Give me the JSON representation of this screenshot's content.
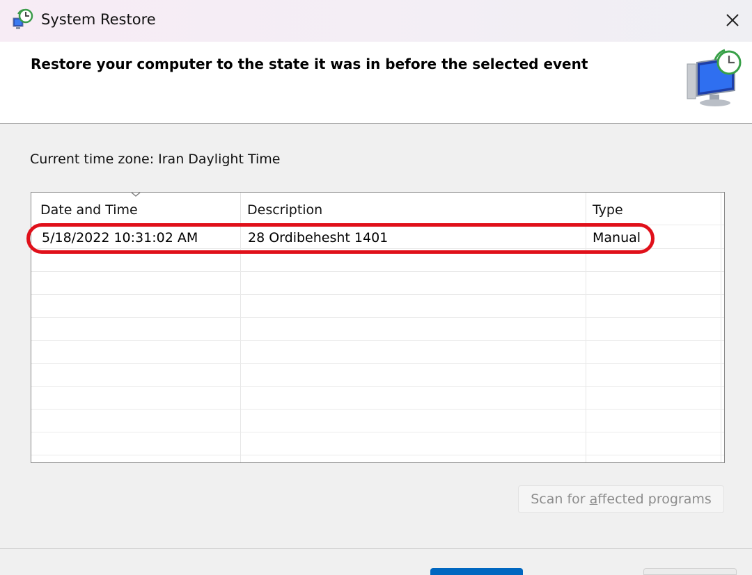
{
  "window": {
    "title": "System Restore",
    "icons": {
      "app": "system-restore-icon",
      "close": "close-icon"
    }
  },
  "header": {
    "title": "Restore your computer to the state it was in before the selected event",
    "icon": "system-restore-monitor-clock-icon"
  },
  "timezone_label": "Current time zone: Iran Daylight Time",
  "restore_points": {
    "columns": [
      "Date and Time",
      "Description",
      "Type"
    ],
    "sort_icon": "chevron-down-icon",
    "rows": [
      {
        "date_time": "5/18/2022 10:31:02 AM",
        "description": "28 Ordibehesht 1401",
        "type": "Manual"
      }
    ],
    "highlight_color": "#e0101a"
  },
  "buttons": {
    "scan_pre": "Scan for ",
    "scan_mnemonic": "a",
    "scan_post": "ffected programs"
  },
  "colors": {
    "accent": "#0067c0",
    "highlight": "#e0101a"
  }
}
